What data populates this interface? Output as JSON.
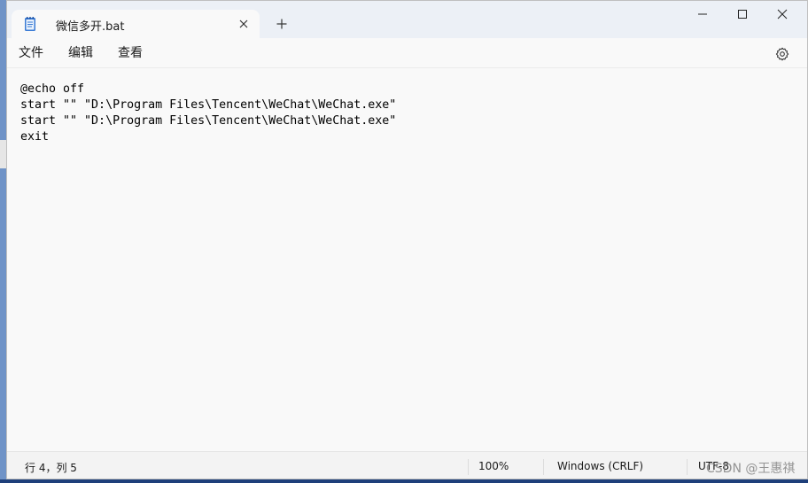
{
  "window": {
    "tab_title": "微信多开.bat",
    "tab_icon": "notepad-icon"
  },
  "menu": {
    "file": "文件",
    "edit": "编辑",
    "view": "查看"
  },
  "editor": {
    "lines": [
      "@echo off",
      "start \"\" \"D:\\Program Files\\Tencent\\WeChat\\WeChat.exe\"",
      "start \"\" \"D:\\Program Files\\Tencent\\WeChat\\WeChat.exe\"",
      "exit"
    ]
  },
  "status": {
    "position": "行 4，列 5",
    "zoom": "100%",
    "line_ending": "Windows (CRLF)",
    "encoding": "UTF-8"
  },
  "watermark": "CSDN @王惠祺",
  "colors": {
    "titlebar": "#ecf0f6",
    "editor_bg": "#f9f9f9",
    "accent_icon": "#3a7bd5"
  }
}
